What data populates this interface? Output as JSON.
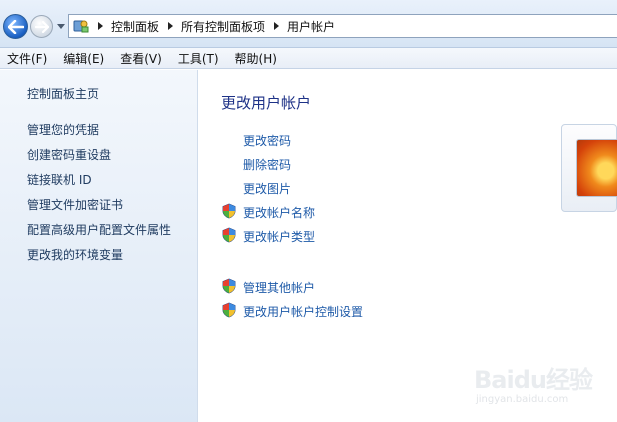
{
  "breadcrumb": {
    "items": [
      "控制面板",
      "所有控制面板项",
      "用户帐户"
    ]
  },
  "menu": {
    "items": [
      "文件(F)",
      "编辑(E)",
      "查看(V)",
      "工具(T)",
      "帮助(H)"
    ]
  },
  "sidebar": {
    "items": [
      "控制面板主页",
      "管理您的凭据",
      "创建密码重设盘",
      "链接联机 ID",
      "管理文件加密证书",
      "配置高级用户配置文件属性",
      "更改我的环境变量"
    ]
  },
  "main": {
    "title": "更改用户帐户",
    "tasks": [
      "更改密码",
      "删除密码",
      "更改图片",
      "更改帐户名称",
      "更改帐户类型"
    ],
    "other_tasks": [
      "管理其他帐户",
      "更改用户帐户控制设置"
    ]
  },
  "watermark": {
    "brand": "Baidu经验",
    "url": "jingyan.baidu.com"
  },
  "colors": {
    "link": "#1e5aa8",
    "title": "#1e3287",
    "sidebar_bg": "#e4edf8"
  },
  "icons": {
    "back": "back-arrow-icon",
    "forward": "forward-arrow-icon",
    "control_panel": "control-panel-icon",
    "uac_shield": "uac-shield-icon"
  }
}
